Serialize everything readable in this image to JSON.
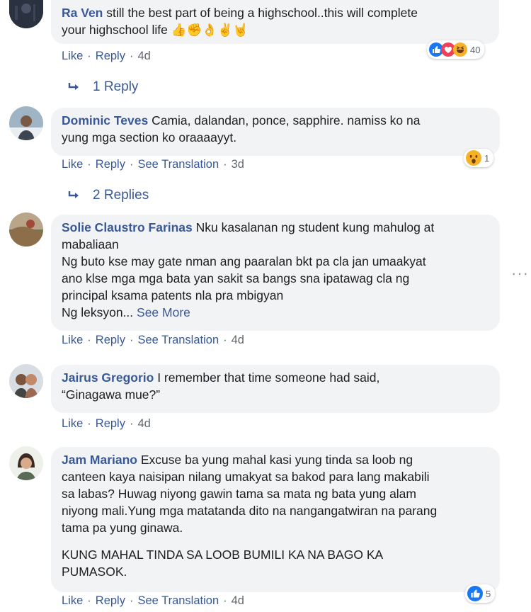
{
  "comments": [
    {
      "author": "Ra Ven",
      "lines": [
        "still the best part of being a highschool..this will complete",
        "your highschool life 👍✊👌✌🤘"
      ],
      "actions": [
        "Like",
        "Reply"
      ],
      "age": "4d",
      "reactions": {
        "icons": [
          "like-reaction-icon",
          "love-reaction-icon",
          "haha-reaction-icon"
        ],
        "count": "40"
      }
    },
    {
      "author": "Dominic Teves",
      "lines": [
        "Camia, dalandan, ponce, sapphire. namiss ko na",
        "yung mga section ko oraaaayyt."
      ],
      "actions": [
        "Like",
        "Reply",
        "See Translation"
      ],
      "age": "3d",
      "reactions": {
        "icons": [
          "wow-reaction-icon"
        ],
        "count": "1"
      }
    },
    {
      "author": "Solie Claustro Farinas",
      "lines": [
        "Nku kasalanan ng student kung mahulog at",
        "mabaliaan",
        "Ng buto kse may gate nman ang paaralan bkt pa cla jan umaakyat",
        "ano klse mga mga bata yan sakit sa bangs sna ipatawag cla ng",
        "principal ksama patents nla pra mbigyan",
        "Ng leksyon..."
      ],
      "see_more": "See More",
      "actions": [
        "Like",
        "Reply",
        "See Translation"
      ],
      "age": "4d"
    },
    {
      "author": "Jairus Gregorio",
      "lines": [
        "I remember that time someone had said,",
        "“Ginagawa mue?”"
      ],
      "actions": [
        "Like",
        "Reply"
      ],
      "age": "4d"
    },
    {
      "author": "Jam Mariano",
      "lines": [
        "Excuse ba yung mahal kasi yung tinda sa loob ng",
        "canteen kaya naisipan nilang umakyat sa bakod para lang makabili",
        "sa labas? Huwag niyong gawin tama sa mata ng bata yung alam",
        "niyong mali.Yung mga matatanda dito na nangangatwiran na parang",
        "tama pa yung ginawa."
      ],
      "lines2": [
        "KUNG MAHAL TINDA SA LOOB BUMILI KA NA BAGO KA",
        "PUMASOK."
      ],
      "actions": [
        "Like",
        "Reply",
        "See Translation"
      ],
      "age": "4d",
      "reactions": {
        "icons": [
          "like-reaction-icon"
        ],
        "count": "5"
      }
    }
  ],
  "reply_links": [
    "1 Reply",
    "2 Replies"
  ],
  "menu_dots": "···",
  "colors": {
    "link": "#385898",
    "bubble": "#f2f3f5",
    "meta": "#606770"
  }
}
